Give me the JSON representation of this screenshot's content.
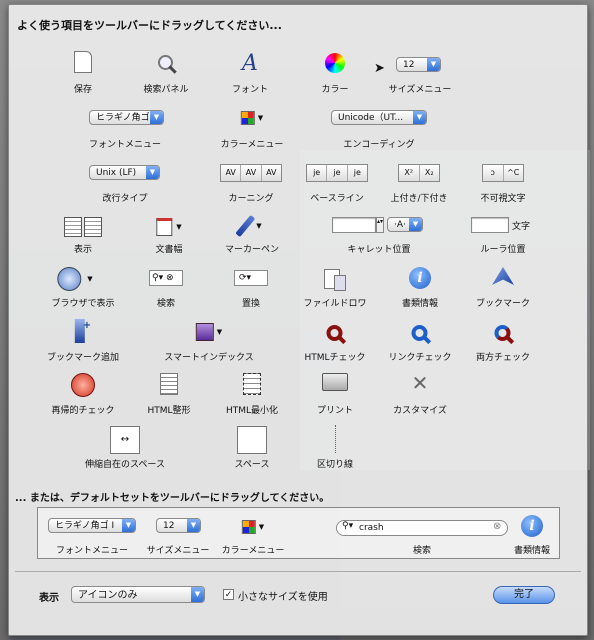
{
  "heading": "よく使う項目をツールバーにドラッグしてください...",
  "heading2": "... または、デフォルトセットをツールバーにドラッグしてください。",
  "items": {
    "save": "保存",
    "search_panel": "検索パネル",
    "font": "フォント",
    "color": "カラー",
    "size_menu": "サイズメニュー",
    "font_menu": "フォントメニュー",
    "color_menu": "カラーメニュー",
    "encoding": "エンコーディング",
    "newline_type": "改行タイプ",
    "kerning": "カーニング",
    "baseline": "ベースライン",
    "superscript_subscript": "上付き/下付き",
    "invisible_chars": "不可視文字",
    "display": "表示",
    "doc_width": "文書幅",
    "marker_pen": "マーカーペン",
    "caret_position": "キャレット位置",
    "ruler_position": "ルーラ位置",
    "browser_display": "ブラウザで表示",
    "search": "検索",
    "replace": "置換",
    "file_drawer": "ファイルドロワ",
    "doc_info": "書類情報",
    "bookmark": "ブックマーク",
    "add_bookmark": "ブックマーク追加",
    "smart_index": "スマートインデックス",
    "html_check": "HTMLチェック",
    "link_check": "リンクチェック",
    "both_check": "両方チェック",
    "recursive_check": "再帰的チェック",
    "html_format": "HTML整形",
    "html_minimize": "HTML最小化",
    "print": "プリント",
    "customize": "カスタマイズ",
    "flexible_space": "伸縮自在のスペース",
    "space": "スペース",
    "separator": "区切り線"
  },
  "controls": {
    "size_value": "12",
    "font_popup": "ヒラギノ角ゴ",
    "encoding_popup": "Unicode（UT...",
    "newline_popup": "Unix (LF)",
    "ruler_unit": "文字",
    "a_glyph": "A",
    "kern_1": "AV",
    "kern_2": "AV",
    "kern_3": "AV",
    "base_1": "je",
    "base_2": "je",
    "base_3": "je",
    "sup": "X²",
    "sub": "X₂",
    "invis": "^C"
  },
  "defaults": {
    "font_popup": "ヒラギノ角ゴ I",
    "size_value": "12",
    "search_value": "crash",
    "font_menu": "フォントメニュー",
    "size_menu": "サイズメニュー",
    "color_menu": "カラーメニュー",
    "search": "検索",
    "doc_info": "書類情報"
  },
  "footer": {
    "show_label": "表示",
    "show_value": "アイコンのみ",
    "small_size_label": "小さなサイズを使用",
    "small_size_checked": "✓",
    "done": "完了"
  }
}
